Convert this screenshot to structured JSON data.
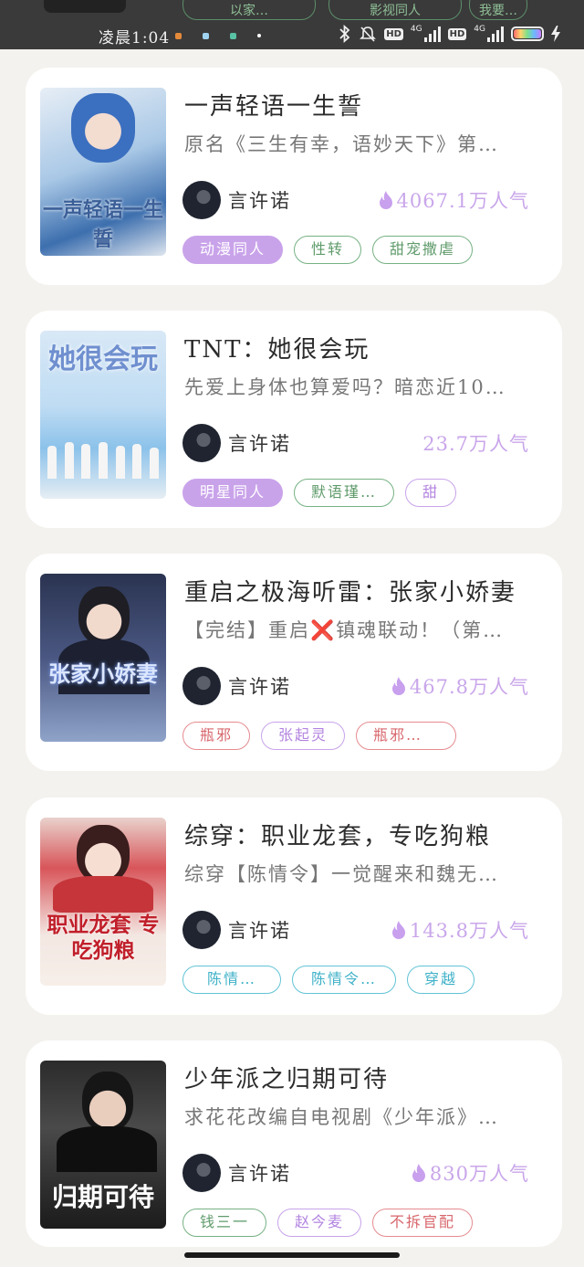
{
  "top_strip": {
    "tags": [
      "以家…",
      "影视同人",
      "我要…"
    ]
  },
  "status_bar": {
    "time": "凌晨1:04",
    "signal1_label": "4G",
    "signal2_label": "4G",
    "hd_label": "HD",
    "icons": [
      "bluetooth-icon",
      "mute-icon",
      "signal-icon",
      "battery-icon",
      "charging-icon"
    ]
  },
  "books": [
    {
      "title": "一声轻语一生誓",
      "desc": "原名《三生有幸，语妙天下》第…",
      "author": "言许诺",
      "popularity": "4067.1万人气",
      "cover_text": "一声轻语一生誓",
      "cover_colors": [
        "#dfe8f2",
        "#6f9fd0",
        "#2f5f9e"
      ],
      "tags": [
        {
          "label": "动漫同人",
          "style": "fill"
        },
        {
          "label": "性转",
          "style": "green"
        },
        {
          "label": "甜宠撒虐",
          "style": "green"
        }
      ]
    },
    {
      "title": "TNT：她很会玩",
      "desc": "先爱上身体也算爱吗？暗恋近10…",
      "author": "言许诺",
      "popularity": "23.7万人气",
      "cover_text": "她很会玩",
      "cover_colors": [
        "#cfe3f5",
        "#9ccaf0",
        "#e9f2fa"
      ],
      "tags": [
        {
          "label": "明星同人",
          "style": "fill"
        },
        {
          "label": "默语瑾…",
          "style": "green"
        },
        {
          "label": "甜",
          "style": "purple"
        }
      ]
    },
    {
      "title": "重启之极海听雷：张家小娇妻",
      "desc": "【完结】重启❌镇魂联动！（第…",
      "author": "言许诺",
      "popularity": "467.8万人气",
      "cover_text": "张家小娇妻",
      "cover_colors": [
        "#2a3350",
        "#56648e",
        "#8fa3c9"
      ],
      "tags": [
        {
          "label": "瓶邪",
          "style": "red"
        },
        {
          "label": "张起灵",
          "style": "purple"
        },
        {
          "label": "瓶邪…",
          "style": "red"
        }
      ]
    },
    {
      "title": "综穿：职业龙套，专吃狗粮",
      "desc": "综穿【陈情令】一觉醒来和魏无…",
      "author": "言许诺",
      "popularity": "143.8万人气",
      "cover_text": "职业龙套 专吃狗粮",
      "cover_colors": [
        "#f3e9e6",
        "#d94a4a",
        "#f6d7cf"
      ],
      "tags": [
        {
          "label": "陈情…",
          "style": "cyan"
        },
        {
          "label": "陈情令…",
          "style": "cyan"
        },
        {
          "label": "穿越",
          "style": "cyan"
        }
      ]
    },
    {
      "title": "少年派之归期可待",
      "desc": "求花花改编自电视剧《少年派》…",
      "author": "言许诺",
      "popularity": "830万人气",
      "cover_text": "归期可待",
      "cover_colors": [
        "#1c1c1c",
        "#3a3a3a",
        "#6a6a6a"
      ],
      "tags": [
        {
          "label": "钱三一",
          "style": "green"
        },
        {
          "label": "赵今麦",
          "style": "purple"
        },
        {
          "label": "不拆官配",
          "style": "red"
        }
      ]
    }
  ]
}
